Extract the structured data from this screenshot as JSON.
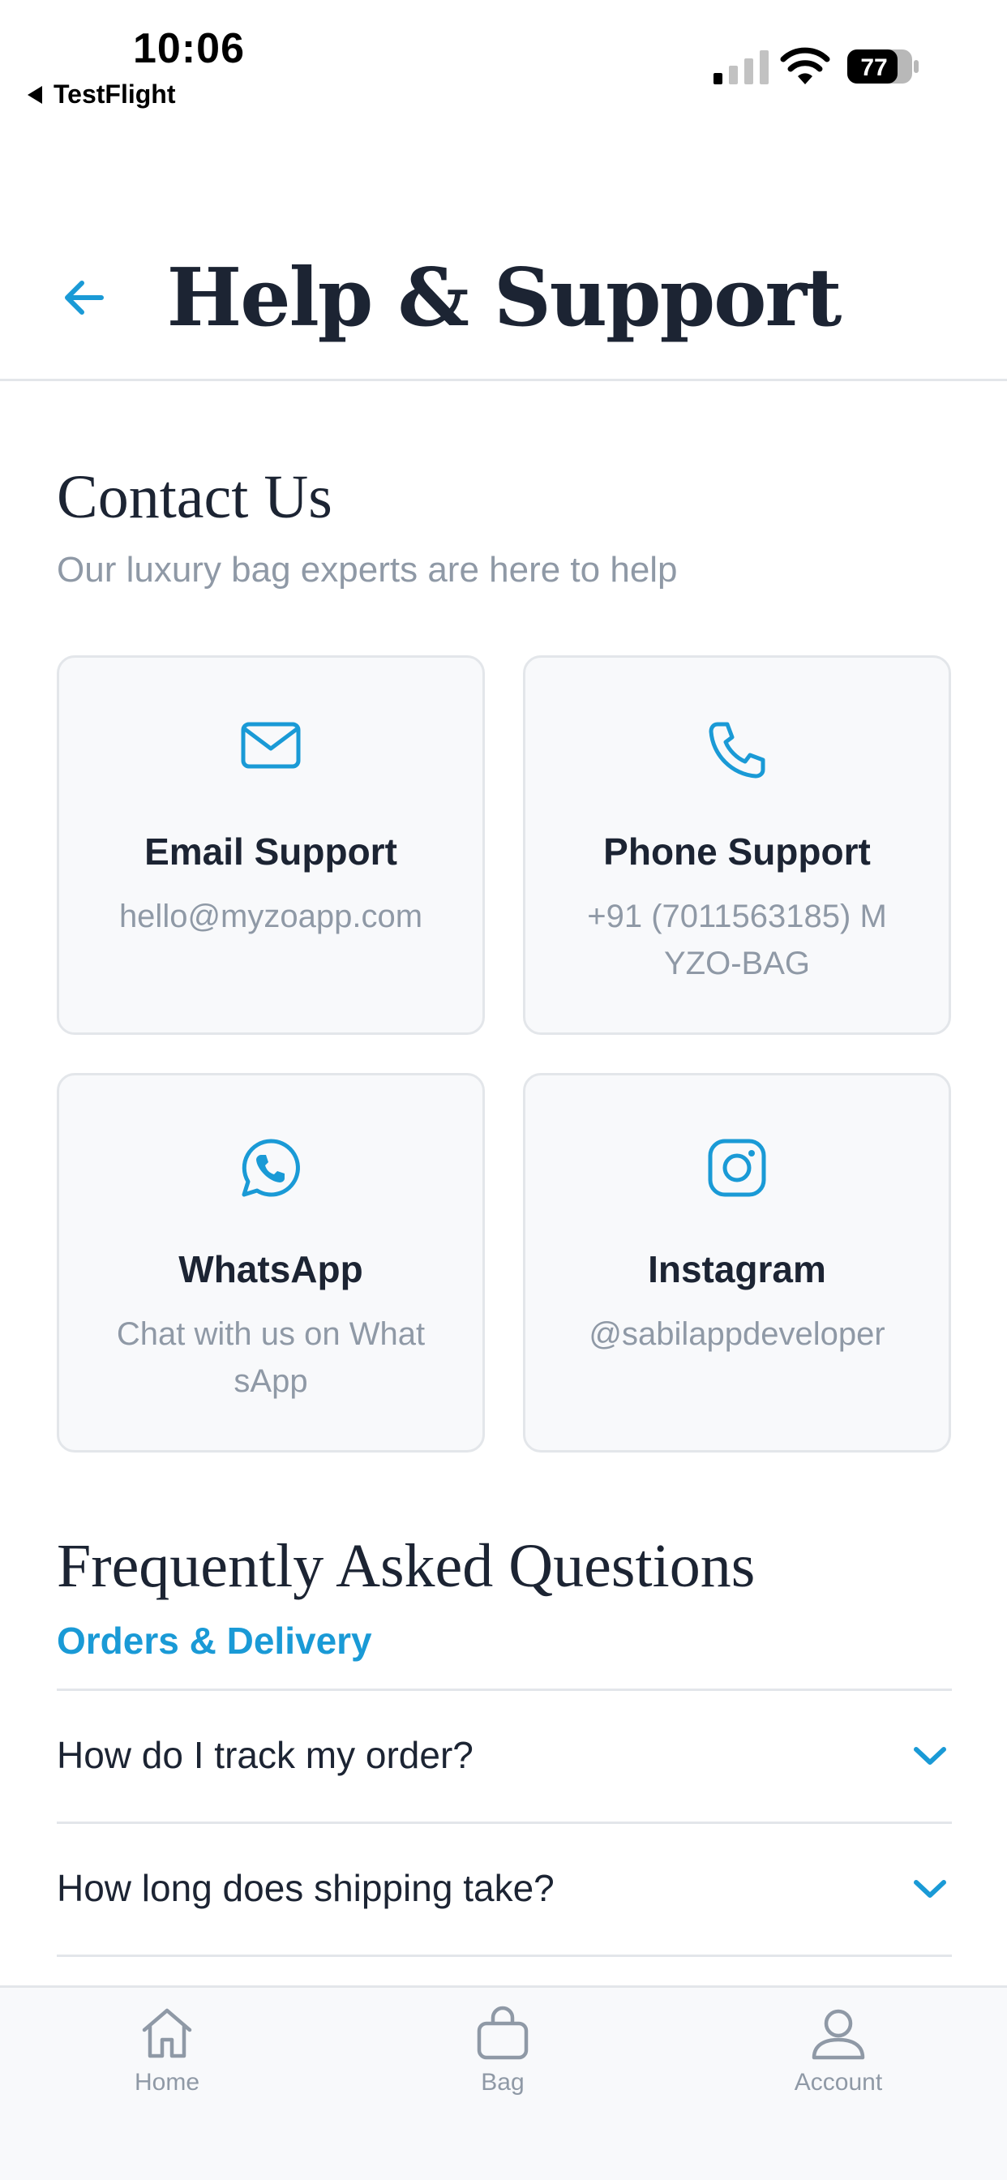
{
  "status_bar": {
    "time": "10:06",
    "back_app": "TestFlight",
    "battery": "77"
  },
  "header": {
    "title": "Help & Support",
    "back_icon": "arrow-left-icon"
  },
  "contact": {
    "title": "Contact Us",
    "subtitle": "Our luxury bag experts are here to help",
    "cards": [
      {
        "icon": "mail-icon",
        "title": "Email Support",
        "subtitle": "hello@myzoapp.com"
      },
      {
        "icon": "phone-icon",
        "title": "Phone Support",
        "subtitle": "+91 (7011563185) MYZO-BAG"
      },
      {
        "icon": "whatsapp-icon",
        "title": "WhatsApp",
        "subtitle": "Chat with us on WhatsApp"
      },
      {
        "icon": "instagram-icon",
        "title": "Instagram",
        "subtitle": "@sabilappdeveloper"
      }
    ]
  },
  "faq": {
    "title": "Frequently Asked Questions",
    "category": "Orders & Delivery",
    "items": [
      {
        "question": "How do I track my order?"
      },
      {
        "question": "How long does shipping take?"
      }
    ]
  },
  "tab_bar": {
    "items": [
      {
        "icon": "home-icon",
        "label": "Home"
      },
      {
        "icon": "bag-icon",
        "label": "Bag"
      },
      {
        "icon": "account-icon",
        "label": "Account"
      }
    ]
  },
  "colors": {
    "accent": "#1a9ad6",
    "text_primary": "#1c2433",
    "text_muted": "#8f99a6",
    "card_bg": "#f8f9fb",
    "divider": "#e3e6ea"
  }
}
